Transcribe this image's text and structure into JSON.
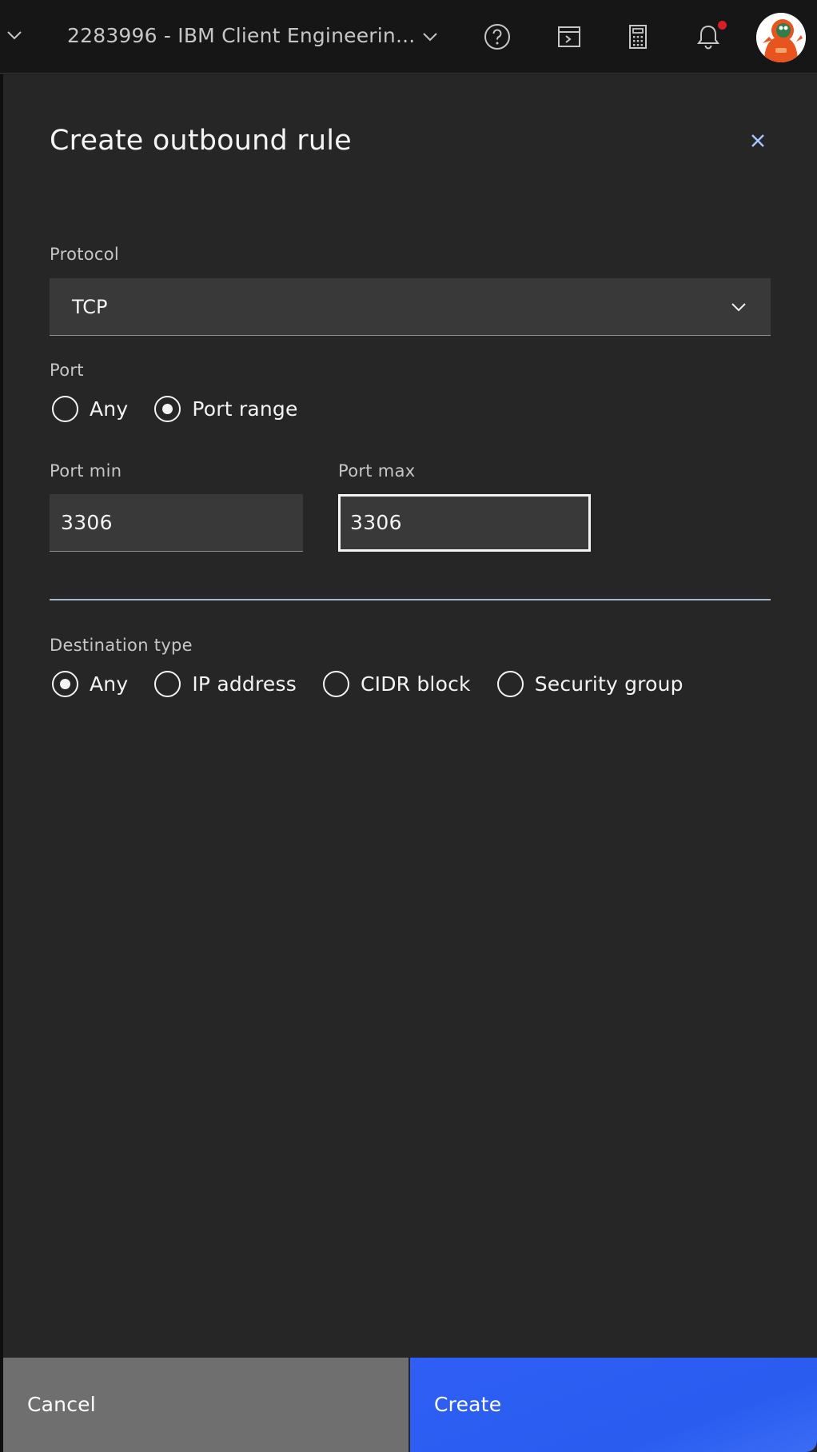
{
  "topbar": {
    "account": "2283996 - IBM Client Engineerin...",
    "icons": [
      "chevron-down-icon",
      "help-icon",
      "cloud-shell-icon",
      "cost-estimator-icon",
      "notification-icon",
      "avatar"
    ],
    "notification_dot_color": "#da1e28"
  },
  "panel": {
    "title": "Create outbound rule",
    "protocol": {
      "label": "Protocol",
      "value": "TCP"
    },
    "port": {
      "label": "Port",
      "options": [
        {
          "label": "Any",
          "checked": false
        },
        {
          "label": "Port range",
          "checked": true
        }
      ]
    },
    "port_min": {
      "label": "Port min",
      "value": "3306"
    },
    "port_max": {
      "label": "Port max",
      "value": "3306"
    },
    "destination": {
      "label": "Destination type",
      "options": [
        {
          "label": "Any",
          "checked": true
        },
        {
          "label": "IP address",
          "checked": false
        },
        {
          "label": "CIDR block",
          "checked": false
        },
        {
          "label": "Security group",
          "checked": false
        }
      ]
    }
  },
  "footer": {
    "cancel": "Cancel",
    "create": "Create"
  },
  "colors": {
    "panel_bg": "#262626",
    "field_bg": "#393939",
    "primary": "#2f5ff5",
    "secondary": "#6f6f6f"
  }
}
